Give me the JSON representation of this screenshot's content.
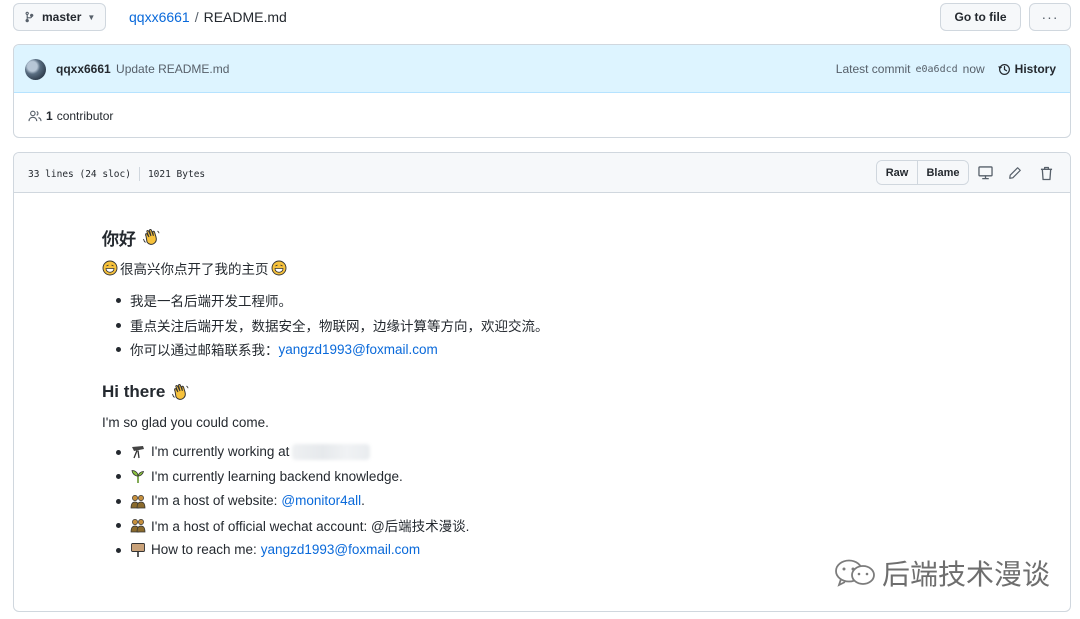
{
  "topbar": {
    "branch": "master",
    "repo": "qqxx6661",
    "separator": "/",
    "file": "README.md",
    "goto_label": "Go to file",
    "more_label": "···"
  },
  "commit": {
    "author": "qqxx6661",
    "message": "Update README.md",
    "latest_label": "Latest commit",
    "sha": "e0a6dcd",
    "time": "now",
    "history_label": "History"
  },
  "contributors": {
    "count": "1",
    "label": "contributor"
  },
  "file_header": {
    "lines": "33 lines (24 sloc)",
    "size": "1021 Bytes",
    "raw_label": "Raw",
    "blame_label": "Blame"
  },
  "readme": {
    "cn_heading": "你好",
    "cn_intro": "很高兴你点开了我的主页",
    "cn_items": [
      {
        "text": "我是一名后端开发工程师。"
      },
      {
        "text": "重点关注后端开发，数据安全，物联网，边缘计算等方向，欢迎交流。"
      },
      {
        "text": "你可以通过邮箱联系我：",
        "link": "yangzd1993@foxmail.com"
      }
    ],
    "en_heading": "Hi there",
    "en_intro": "I'm so glad you could come.",
    "en_items": [
      {
        "icon": "telescope-icon",
        "text": "I'm currently working at"
      },
      {
        "icon": "seedling-icon",
        "text": "I'm currently learning backend knowledge."
      },
      {
        "icon": "people-icon",
        "text": "I'm a host of website: ",
        "link": "@monitor4all",
        "suffix": "."
      },
      {
        "icon": "people-icon",
        "text": "I'm a host of official wechat account: @后端技术漫谈."
      },
      {
        "icon": "sign-icon",
        "text": "How to reach me: ",
        "link": "yangzd1993@foxmail.com"
      }
    ]
  },
  "watermark": {
    "text": "后端技术漫谈"
  },
  "colors": {
    "link": "#0969da",
    "commit_bg": "#ddf4ff",
    "border": "#d0d7de"
  }
}
